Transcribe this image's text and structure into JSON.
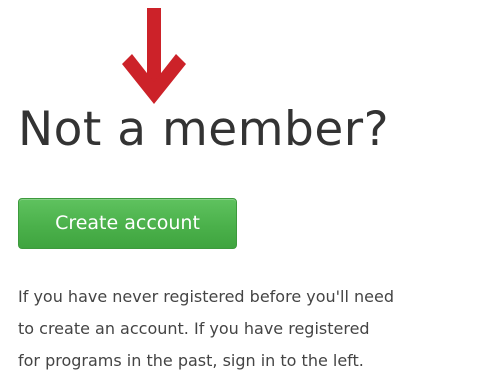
{
  "indicator": {
    "icon": "arrow-down-icon",
    "color": "#cc2229"
  },
  "signup": {
    "heading": "Not a member?",
    "button_label": "Create account",
    "button_color": "#4cb04c",
    "description_lines": [
      "If you have never registered before you'll need",
      "to create an account. If you have registered",
      "for programs in the past, sign in to the left."
    ]
  }
}
